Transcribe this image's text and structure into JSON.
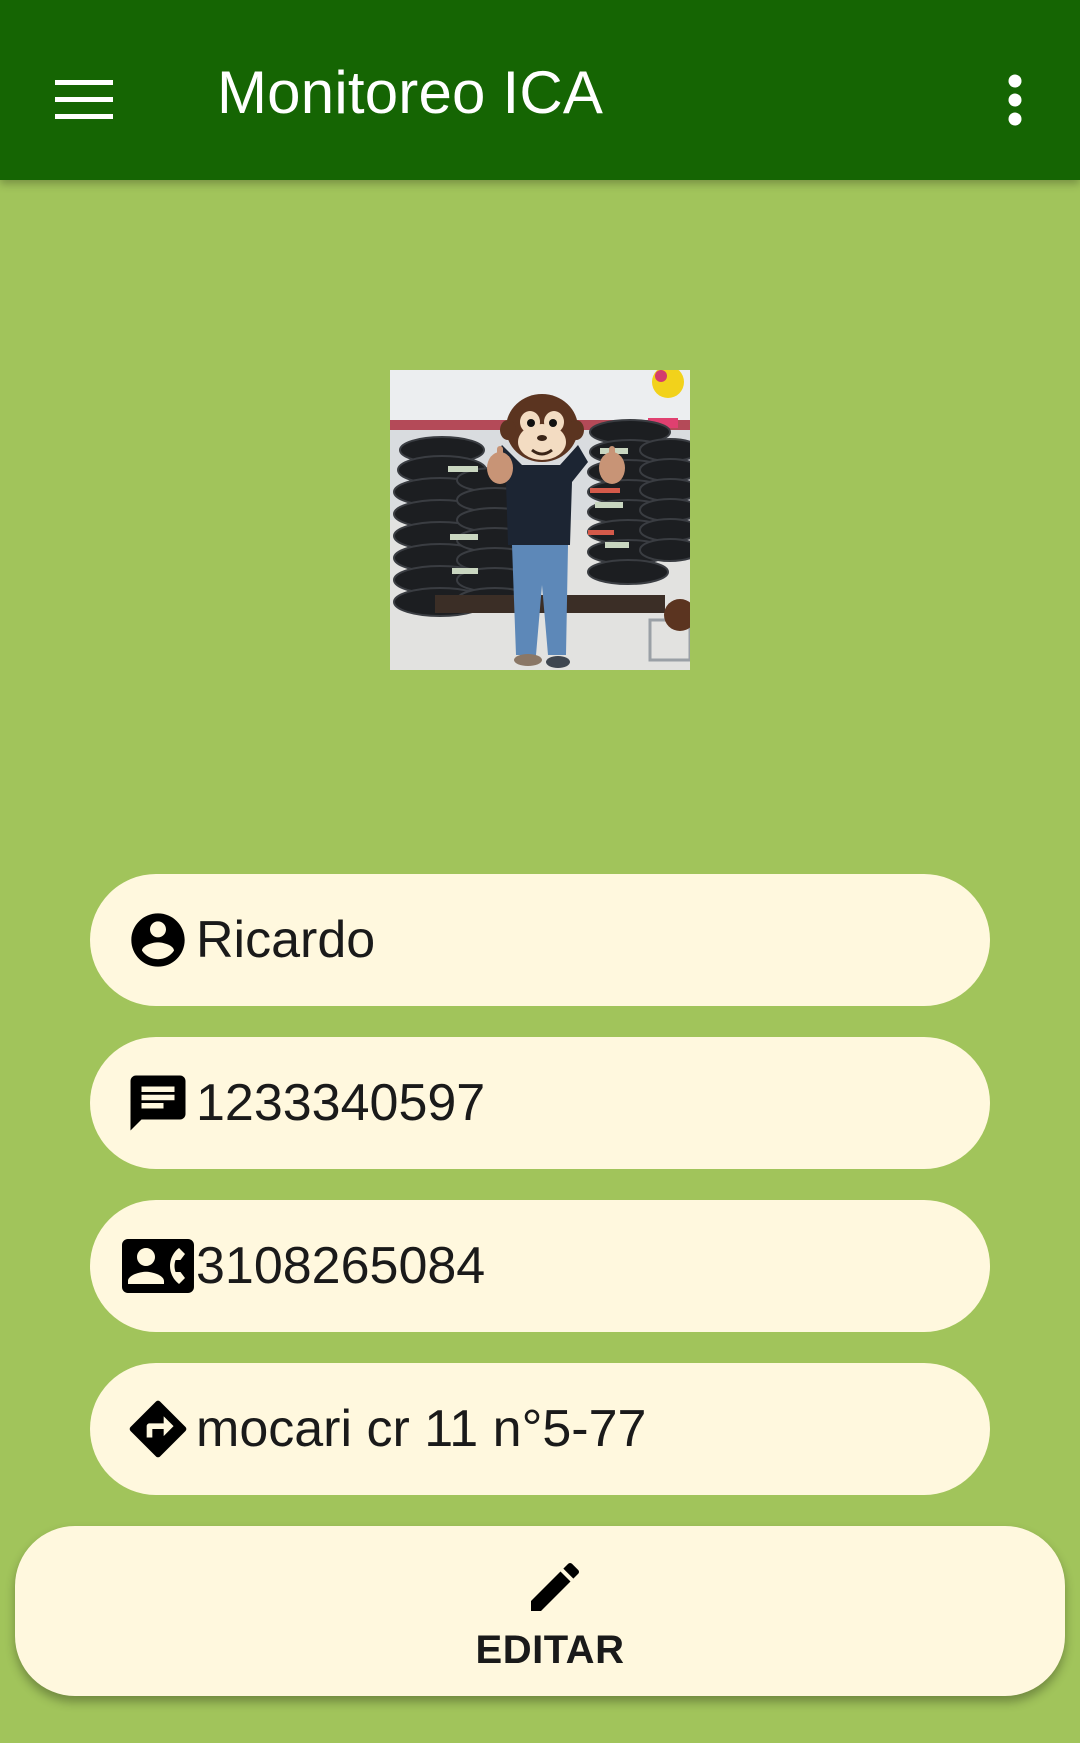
{
  "app": {
    "title": "Monitoreo ICA"
  },
  "toolbar": {
    "menu_icon": "hamburger-menu-icon",
    "more_icon": "more-vert-icon"
  },
  "profile": {
    "photo": "person-with-monkey-head-at-tire-store",
    "fields": [
      {
        "icon": "account-circle-icon",
        "value": "Ricardo"
      },
      {
        "icon": "message-icon",
        "value": "1233340597"
      },
      {
        "icon": "contact-phone-icon",
        "value": "3108265084"
      },
      {
        "icon": "directions-icon",
        "value": "mocari cr 11 n°5-77"
      }
    ]
  },
  "actions": {
    "edit_label": "EDITAR",
    "edit_icon": "pencil-icon"
  },
  "colors": {
    "appbar": "#156503",
    "background": "#a1c45b",
    "card": "#fff8de",
    "text": "#1a1a1a"
  }
}
